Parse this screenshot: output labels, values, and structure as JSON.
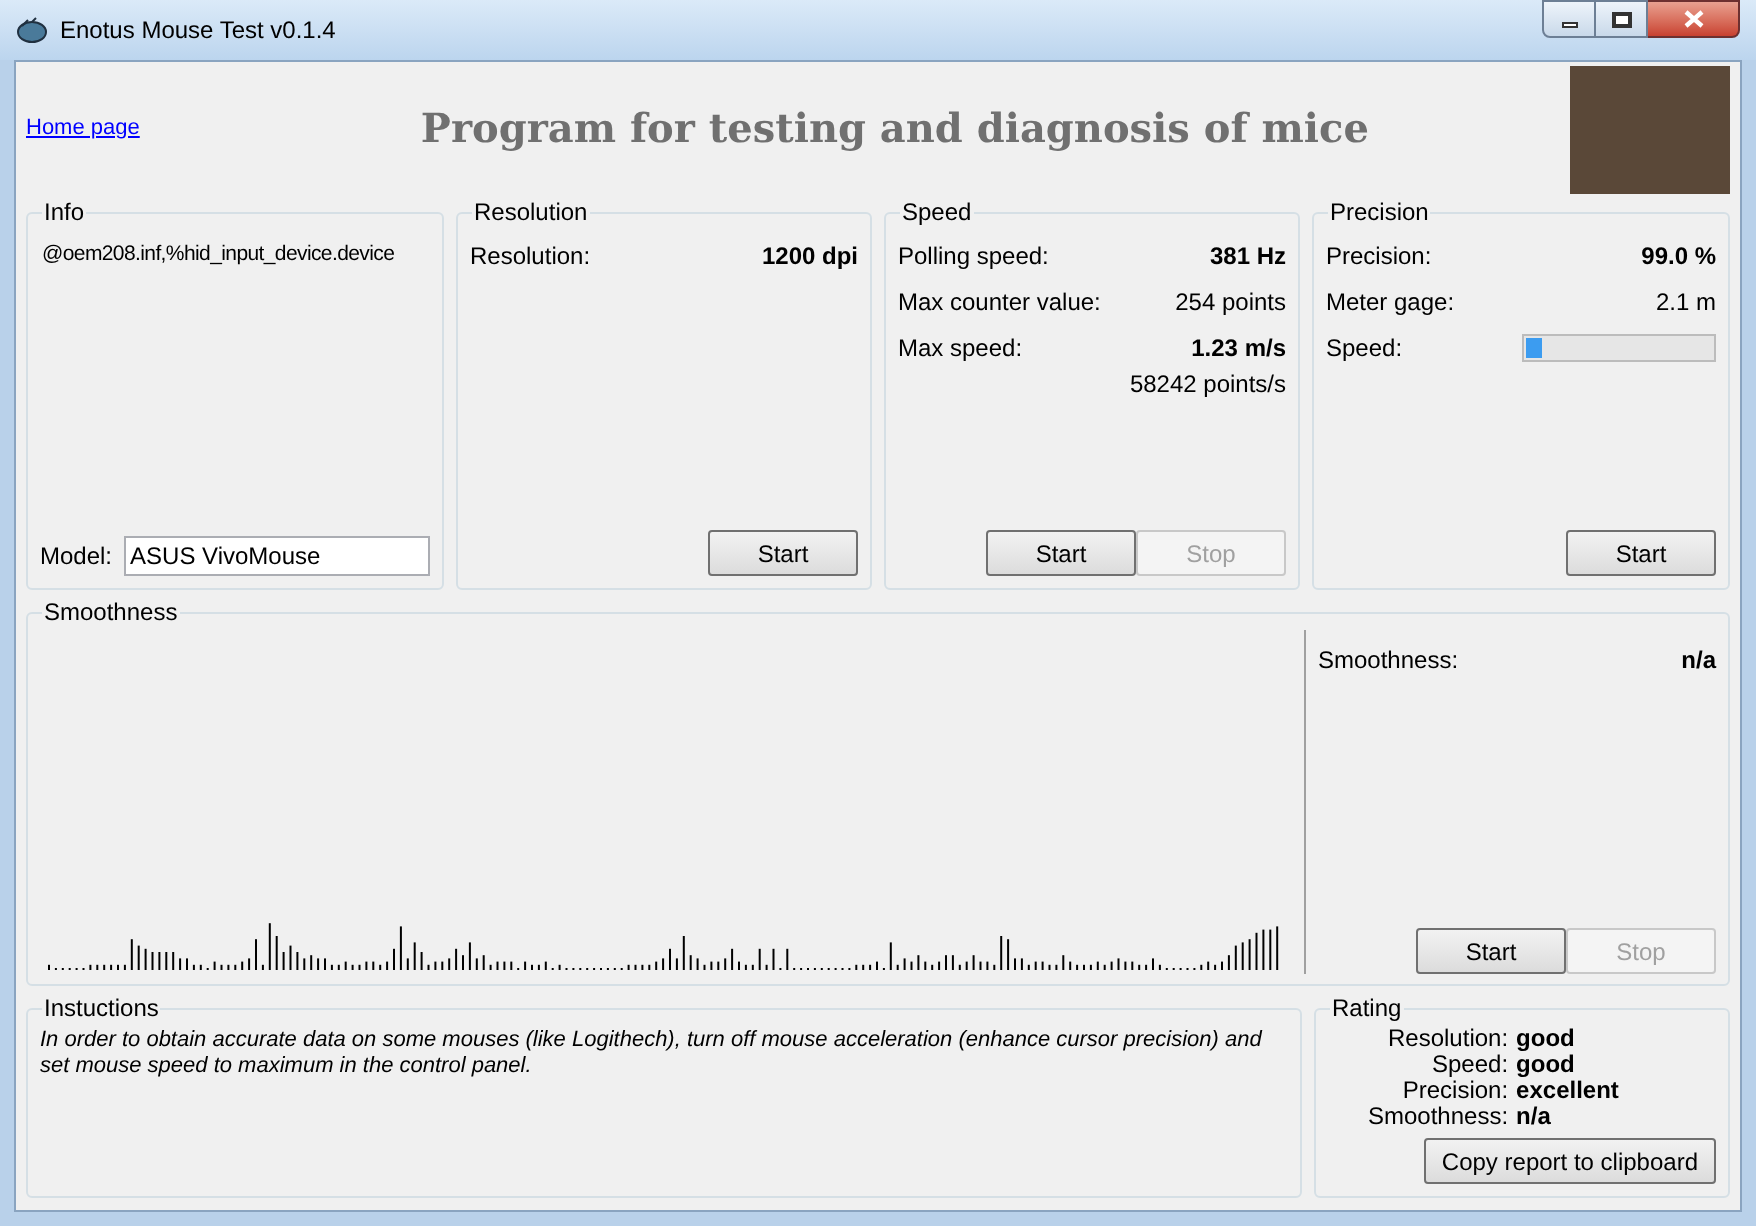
{
  "window": {
    "title": "Enotus Mouse Test v0.1.4"
  },
  "header": {
    "link": "Home page",
    "heading": "Program for testing and diagnosis of mice"
  },
  "info": {
    "title": "Info",
    "device": "@oem208.inf,%hid_input_device.device",
    "model_label": "Model:",
    "model_value": "ASUS VivoMouse"
  },
  "resolution": {
    "title": "Resolution",
    "rows": [
      {
        "label": "Resolution:",
        "value": "1200 dpi",
        "bold": true
      }
    ],
    "buttons": [
      {
        "label": "Start",
        "disabled": false
      }
    ]
  },
  "speed": {
    "title": "Speed",
    "rows": [
      {
        "label": "Polling speed:",
        "value": "381 Hz",
        "bold": true
      },
      {
        "label": "Max counter value:",
        "value": "254 points",
        "bold": false
      },
      {
        "label": "Max  speed:",
        "value": "1.23 m/s",
        "bold": true,
        "sub": "58242 points/s"
      }
    ],
    "buttons": [
      {
        "label": "Start",
        "disabled": false
      },
      {
        "label": "Stop",
        "disabled": true
      }
    ]
  },
  "precision": {
    "title": "Precision",
    "rows": [
      {
        "label": "Precision:",
        "value": "99.0 %",
        "bold": true
      },
      {
        "label": "Meter gage:",
        "value": "2.1 m",
        "bold": false
      }
    ],
    "meter": {
      "label": "Speed:",
      "level": 0.09
    },
    "buttons": [
      {
        "label": "Start",
        "disabled": false
      }
    ]
  },
  "smoothness": {
    "title": "Smoothness",
    "label": "Smoothness:",
    "value": "n/a",
    "buttons": [
      {
        "label": "Start",
        "disabled": false
      },
      {
        "label": "Stop",
        "disabled": true
      }
    ]
  },
  "instructions": {
    "title": "Instuctions",
    "text": "In order to obtain accurate data on some mouses (like Logithech), turn off mouse acceleration (enhance cursor precision) and set mouse speed to maximum in the control panel."
  },
  "rating": {
    "title": "Rating",
    "rows": [
      {
        "label": "Resolution:",
        "value": "good"
      },
      {
        "label": "Speed:",
        "value": "good"
      },
      {
        "label": "Precision:",
        "value": "excellent"
      },
      {
        "label": "Smoothness:",
        "value": "n/a"
      }
    ],
    "button": "Copy report to clipboard"
  }
}
